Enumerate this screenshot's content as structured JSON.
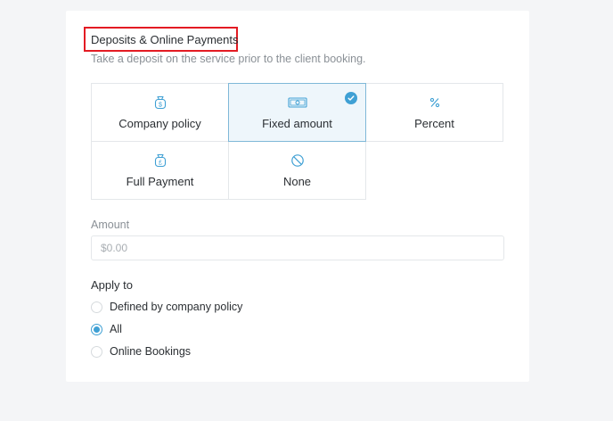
{
  "section": {
    "title": "Deposits & Online Payments",
    "subtitle": "Take a deposit on the service prior to the client booking."
  },
  "deposit_options": [
    {
      "label": "Company policy",
      "icon": "money-bag-dollar-icon",
      "selected": false
    },
    {
      "label": "Fixed amount",
      "icon": "banknote-icon",
      "selected": true
    },
    {
      "label": "Percent",
      "icon": "percent-icon",
      "selected": false
    },
    {
      "label": "Full Payment",
      "icon": "money-bag-pound-icon",
      "selected": false
    },
    {
      "label": "None",
      "icon": "none-icon",
      "selected": false
    }
  ],
  "amount": {
    "label": "Amount",
    "placeholder": "$0.00",
    "value": ""
  },
  "apply_to": {
    "label": "Apply to",
    "options": [
      "Defined by company policy",
      "All",
      "Online Bookings"
    ],
    "selected": "All"
  },
  "colors": {
    "accent": "#3fa0d4",
    "highlight_box": "#e31b23",
    "selected_bg": "#eef6fb"
  }
}
